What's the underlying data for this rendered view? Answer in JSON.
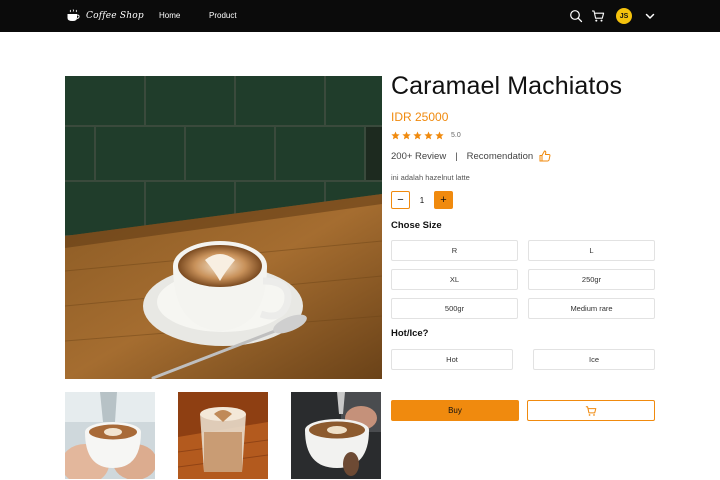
{
  "navbar": {
    "brand_name": "Coffee Shop",
    "links": [
      {
        "label": "Home"
      },
      {
        "label": "Product"
      }
    ],
    "avatar_initials": "JS",
    "icons": [
      "search-icon",
      "cart-icon",
      "chevron-down-icon"
    ]
  },
  "product": {
    "title": "Caramael Machiatos",
    "price": "IDR 25000",
    "rating": 5,
    "rating_label": "5.0",
    "reviews": "200+ Review",
    "separator": "|",
    "recommendation": "Recomendation",
    "description": "ini adalah hazelnut latte",
    "quantity": {
      "decrement": "−",
      "value": "1",
      "increment": "+"
    }
  },
  "size": {
    "label": "Chose Size",
    "options": [
      "R",
      "L",
      "XL",
      "250gr",
      "500gr",
      "Medium rare"
    ]
  },
  "temperature": {
    "label": "Hot/Ice?",
    "options": [
      "Hot",
      "Ice"
    ]
  },
  "actions": {
    "buy": "Buy"
  },
  "colors": {
    "accent": "#f08a0e",
    "navbar": "#0b0b0b",
    "avatar": "#f4c20d"
  }
}
